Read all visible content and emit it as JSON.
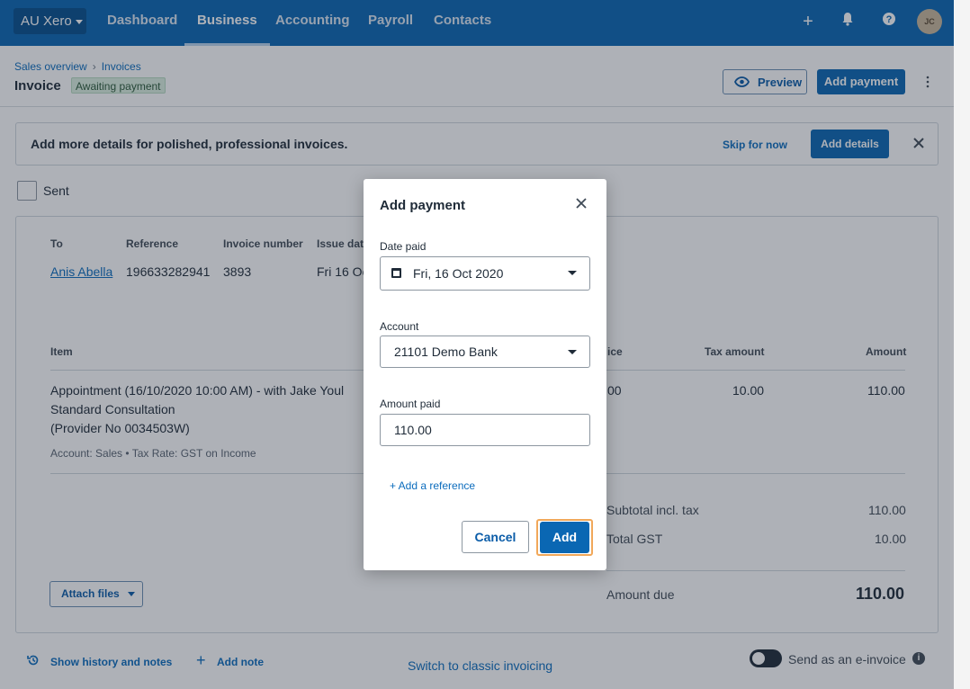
{
  "topnav": {
    "org_label": "AU Xero",
    "items": [
      "Dashboard",
      "Business",
      "Accounting",
      "Payroll",
      "Contacts"
    ],
    "active": "Business",
    "avatar_initials": "JC"
  },
  "breadcrumb": {
    "level1": "Sales overview",
    "level2": "Invoices"
  },
  "header": {
    "title": "Invoice",
    "status": "Awaiting payment",
    "preview_label": "Preview",
    "add_payment_label": "Add payment"
  },
  "banner": {
    "text": "Add more details for polished, professional invoices.",
    "skip_label": "Skip for now",
    "add_details_label": "Add details"
  },
  "sent": {
    "label": "Sent"
  },
  "invoice": {
    "headers": {
      "to": "To",
      "reference": "Reference",
      "invoice_number": "Invoice number",
      "issue_date": "Issue dat"
    },
    "to": "Anis Abella",
    "reference": "196633282941",
    "invoice_number": "3893",
    "issue_date": "Fri 16 Oc",
    "items_headers": {
      "item": "Item",
      "price": "ice",
      "tax_amount": "Tax amount",
      "amount": "Amount"
    },
    "line": {
      "desc1": "Appointment (16/10/2020 10:00 AM) - with Jake Youl",
      "desc2": "Standard Consultation",
      "desc3": "(Provider No 0034503W)",
      "meta": "Account: Sales • Tax Rate: GST on Income",
      "price": "00",
      "tax": "10.00",
      "amount": "110.00"
    },
    "subtotal_label": "Subtotal incl. tax",
    "subtotal": "110.00",
    "gst_label": "Total GST",
    "gst": "10.00",
    "amount_due_label": "Amount due",
    "amount_due": "110.00",
    "attach_label": "Attach files"
  },
  "footer": {
    "history_label": "Show history and notes",
    "add_note_label": "Add note",
    "classic_label": "Switch to classic invoicing",
    "einvoice_label": "Send as an e-invoice"
  },
  "modal": {
    "title": "Add payment",
    "date_label": "Date paid",
    "date_value": "Fri, 16 Oct 2020",
    "account_label": "Account",
    "account_value": "21101 Demo Bank",
    "amount_label": "Amount paid",
    "amount_value": "110.00",
    "add_reference_label": "+ Add a reference",
    "cancel_label": "Cancel",
    "add_label": "Add"
  },
  "icons": [
    "caret-down-icon",
    "plus-icon",
    "bell-icon",
    "help-icon",
    "eye-icon",
    "more-vertical-icon",
    "close-icon",
    "calendar-icon",
    "history-icon",
    "info-icon"
  ],
  "colors": {
    "nav": "#0a67b3",
    "primary_button": "#0a67b3",
    "focus_ring": "#f1a85a",
    "status_badge": "#dcefe0"
  }
}
